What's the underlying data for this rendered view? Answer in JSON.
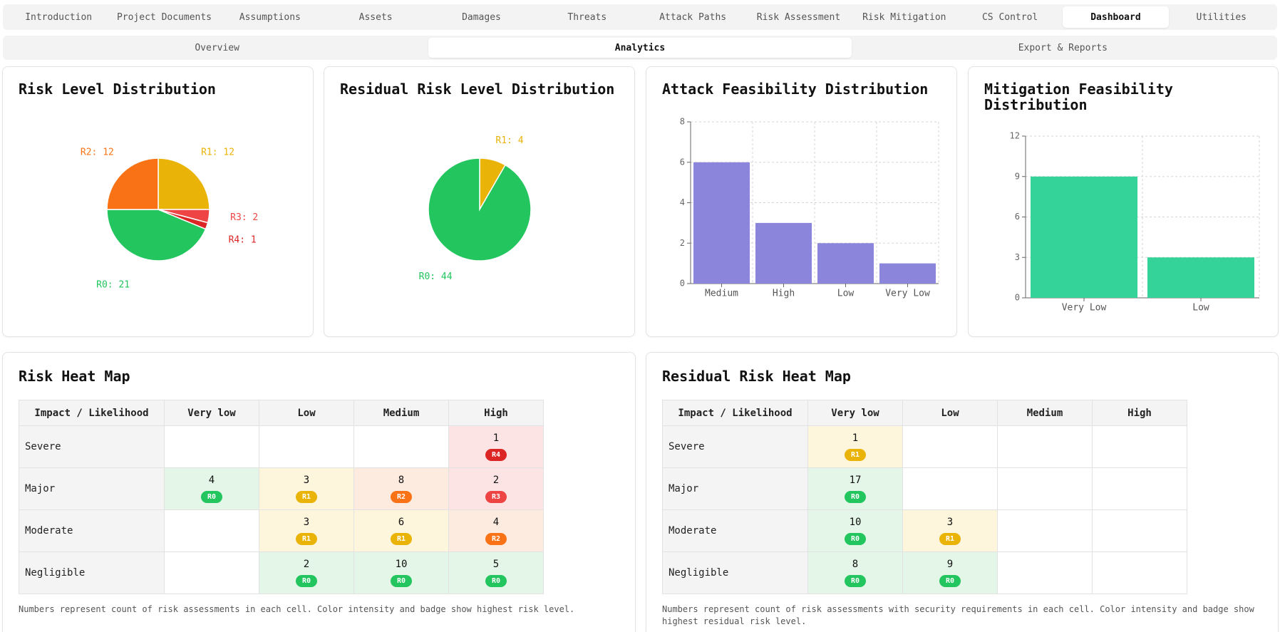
{
  "topnav": {
    "tabs": [
      "Introduction",
      "Project Documents",
      "Assumptions",
      "Assets",
      "Damages",
      "Threats",
      "Attack Paths",
      "Risk Assessment",
      "Risk Mitigation",
      "CS Control",
      "Dashboard",
      "Utilities"
    ],
    "active": 10
  },
  "subnav": {
    "tabs": [
      "Overview",
      "Analytics",
      "Export & Reports"
    ],
    "active": 1
  },
  "colors": {
    "R0": "#22c55e",
    "R1": "#eab308",
    "R2": "#f97316",
    "R3": "#ef4444",
    "R4": "#dc2626",
    "bar_attack": "#8b86dc",
    "bar_mitigation": "#34d399"
  },
  "risk_pie": {
    "title": "Risk Level Distribution",
    "slices": [
      {
        "label": "R1: 12",
        "level": "R1",
        "value": 12
      },
      {
        "label": "R3: 2",
        "level": "R3",
        "value": 2
      },
      {
        "label": "R4: 1",
        "level": "R4",
        "value": 1
      },
      {
        "label": "R0: 21",
        "level": "R0",
        "value": 21
      },
      {
        "label": "R2: 12",
        "level": "R2",
        "value": 12
      }
    ]
  },
  "residual_pie": {
    "title": "Residual Risk Level Distribution",
    "slices": [
      {
        "label": "R1: 4",
        "level": "R1",
        "value": 4
      },
      {
        "label": "R0: 44",
        "level": "R0",
        "value": 44
      }
    ]
  },
  "chart_data": [
    {
      "type": "pie",
      "title": "Risk Level Distribution",
      "categories": [
        "R1",
        "R3",
        "R4",
        "R0",
        "R2"
      ],
      "values": [
        12,
        2,
        1,
        21,
        12
      ]
    },
    {
      "type": "pie",
      "title": "Residual Risk Level Distribution",
      "categories": [
        "R1",
        "R0"
      ],
      "values": [
        4,
        44
      ]
    },
    {
      "type": "bar",
      "title": "Attack Feasibility Distribution",
      "categories": [
        "Medium",
        "High",
        "Low",
        "Very Low"
      ],
      "values": [
        6,
        3,
        2,
        1
      ],
      "ylim": [
        0,
        8
      ],
      "yticks": [
        0,
        2,
        4,
        6,
        8
      ],
      "grid": true
    },
    {
      "type": "bar",
      "title": "Mitigation Feasibility Distribution",
      "categories": [
        "Very Low",
        "Low"
      ],
      "values": [
        9,
        3
      ],
      "ylim": [
        0,
        12
      ],
      "yticks": [
        0,
        3,
        6,
        9,
        12
      ],
      "grid": true
    }
  ],
  "attack_bar": {
    "title": "Attack Feasibility Distribution"
  },
  "mitigation_bar": {
    "title_line1": "Mitigation Feasibility",
    "title_line2": "Distribution"
  },
  "heatmap": {
    "title": "Risk Heat Map",
    "header": [
      "Impact / Likelihood",
      "Very low",
      "Low",
      "Medium",
      "High"
    ],
    "rows": [
      {
        "label": "Severe",
        "cells": [
          null,
          null,
          null,
          {
            "count": "1",
            "level": "R4"
          }
        ]
      },
      {
        "label": "Major",
        "cells": [
          {
            "count": "4",
            "level": "R0"
          },
          {
            "count": "3",
            "level": "R1"
          },
          {
            "count": "8",
            "level": "R2"
          },
          {
            "count": "2",
            "level": "R3"
          }
        ]
      },
      {
        "label": "Moderate",
        "cells": [
          null,
          {
            "count": "3",
            "level": "R1"
          },
          {
            "count": "6",
            "level": "R1"
          },
          {
            "count": "4",
            "level": "R2"
          }
        ]
      },
      {
        "label": "Negligible",
        "cells": [
          null,
          {
            "count": "2",
            "level": "R0"
          },
          {
            "count": "10",
            "level": "R0"
          },
          {
            "count": "5",
            "level": "R0"
          }
        ]
      }
    ],
    "note": "Numbers represent count of risk assessments in each cell. Color intensity and badge show highest risk level."
  },
  "residual_heatmap": {
    "title": "Residual Risk Heat Map",
    "header": [
      "Impact / Likelihood",
      "Very low",
      "Low",
      "Medium",
      "High"
    ],
    "rows": [
      {
        "label": "Severe",
        "cells": [
          {
            "count": "1",
            "level": "R1"
          },
          null,
          null,
          null
        ]
      },
      {
        "label": "Major",
        "cells": [
          {
            "count": "17",
            "level": "R0"
          },
          null,
          null,
          null
        ]
      },
      {
        "label": "Moderate",
        "cells": [
          {
            "count": "10",
            "level": "R0"
          },
          {
            "count": "3",
            "level": "R1"
          },
          null,
          null
        ]
      },
      {
        "label": "Negligible",
        "cells": [
          {
            "count": "8",
            "level": "R0"
          },
          {
            "count": "9",
            "level": "R0"
          },
          null,
          null
        ]
      }
    ],
    "note_line1": "Numbers represent count of risk assessments with security requirements in each cell. Color intensity and badge show",
    "note_line2": "highest residual risk level."
  }
}
